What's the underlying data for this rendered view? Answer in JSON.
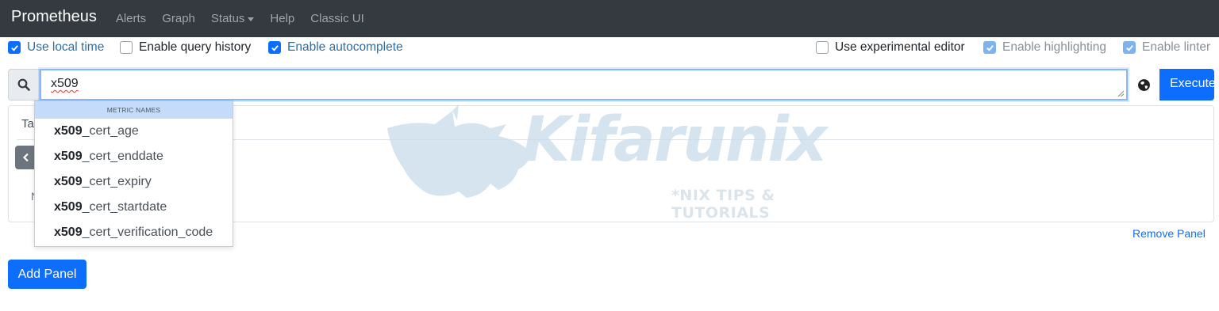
{
  "navbar": {
    "brand": "Prometheus",
    "links": [
      "Alerts",
      "Graph",
      "Status",
      "Help",
      "Classic UI"
    ]
  },
  "options": {
    "use_local_time": {
      "label": "Use local time",
      "checked": true
    },
    "enable_query_history": {
      "label": "Enable query history",
      "checked": false
    },
    "enable_autocomplete": {
      "label": "Enable autocomplete",
      "checked": true
    },
    "use_experimental_editor": {
      "label": "Use experimental editor",
      "checked": false
    },
    "enable_highlighting": {
      "label": "Enable highlighting",
      "checked": true
    },
    "enable_linter": {
      "label": "Enable linter",
      "checked": true
    }
  },
  "expression": {
    "value": "x509",
    "execute_label": "Execute"
  },
  "autocomplete": {
    "header": "METRIC NAMES",
    "match": "x509",
    "items": [
      {
        "match": "x509",
        "rest": "_cert_age"
      },
      {
        "match": "x509",
        "rest": "_cert_enddate"
      },
      {
        "match": "x509",
        "rest": "_cert_expiry"
      },
      {
        "match": "x509",
        "rest": "_cert_startdate"
      },
      {
        "match": "x509",
        "rest": "_cert_verification_code"
      }
    ]
  },
  "panel": {
    "tab_label": "Ta",
    "no_data_char": "N",
    "remove_label": "Remove Panel"
  },
  "add_panel_label": "Add Panel",
  "watermark": {
    "title": "Kifarunix",
    "subtitle": "*NIX TIPS & TUTORIALS"
  },
  "colors": {
    "navbar_bg": "#343a40",
    "primary": "#0d6efd",
    "autocomplete_header_bg": "#c4dcf9"
  }
}
